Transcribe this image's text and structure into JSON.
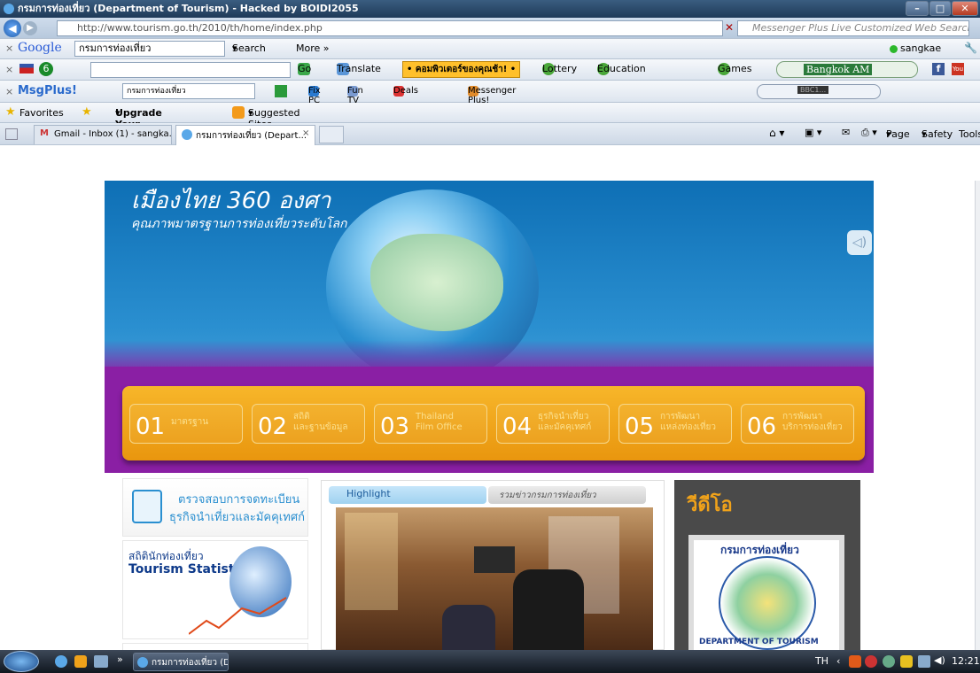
{
  "window": {
    "title": "กรมการท่องเที่ยว (Department of Tourism) - Hacked by BOIDI2055"
  },
  "address": {
    "url": "http://www.tourism.go.th/2010/th/home/index.php",
    "search_placeholder": "Messenger Plus Live Customized Web Search"
  },
  "google_bar": {
    "logo": "Google",
    "query": "กรมการท่องเที่ยว",
    "search_label": "Search",
    "more_label": "More »",
    "user": "sangkae"
  },
  "toolbar2": {
    "go_label": "Go",
    "translate_label": "Translate",
    "promo_label": "• คอมพิวเตอร์ของคุณช้า! •",
    "lottery_label": "Lottery",
    "education_label": "Education",
    "games_label": "Games",
    "radio_label": "Bangkok AM"
  },
  "toolbar3": {
    "brand": "MsgPlus!",
    "query": "กรมการท่องเที่ยว",
    "fixpc_label": "Fix PC",
    "funtv_label": "Fun TV",
    "deals_label": "Deals",
    "messenger_label": "Messenger Plus!",
    "player_label": "BBC1..."
  },
  "favorites": {
    "favorites_label": "Favorites",
    "upgrade_label": "Upgrade Your Browser",
    "suggested_label": "Suggested Sites"
  },
  "tabs": [
    {
      "label": "Gmail - Inbox (1) - sangka..."
    },
    {
      "label": "กรมการท่องเที่ยว (Depart..."
    }
  ],
  "command_bar": {
    "page_label": "Page",
    "safety_label": "Safety",
    "tools_label": "Tools"
  },
  "banner": {
    "slogan": "เมืองไทย 360 องศา",
    "slogan_line2": "คุณภาพมาตรฐานการท่องเที่ยวระดับโลก",
    "menu": [
      {
        "num": "01",
        "text": "มาตรฐาน"
      },
      {
        "num": "02",
        "text": "สถิติ\nและฐานข้อมูล"
      },
      {
        "num": "03",
        "text": "Thailand\nFilm Office"
      },
      {
        "num": "04",
        "text": "ธุรกิจนำเที่ยว\nและมัคคุเทศก์"
      },
      {
        "num": "05",
        "text": "การพัฒนา\nแหล่งท่องเที่ยว"
      },
      {
        "num": "06",
        "text": "การพัฒนา\nบริการท่องเที่ยว"
      }
    ]
  },
  "left": {
    "check_line1": "ตรวจสอบการจดทะเบียน",
    "check_line2": "ธุรกิจนำเที่ยวและมัคคุเทศก์",
    "stats_thai": "สถิตินักท่องเที่ยว",
    "stats_en": "Tourism Statistics"
  },
  "highlight": {
    "tab_active": "Highlight",
    "tab_other": "รวมข่าวกรมการท่องเที่ยว"
  },
  "video": {
    "heading": "วีดีโอ",
    "logo_top": "กรมการท่องเที่ยว",
    "logo_bottom": "DEPARTMENT OF TOURISM"
  },
  "taskbar": {
    "task_label": "กรมการท่องเที่ยว (De...",
    "lang": "TH",
    "clock": "12:21"
  },
  "colors": {
    "accent_orange": "#f0a21a",
    "banner_purple": "#8a1fa4",
    "sky_blue": "#2a8fd0"
  }
}
